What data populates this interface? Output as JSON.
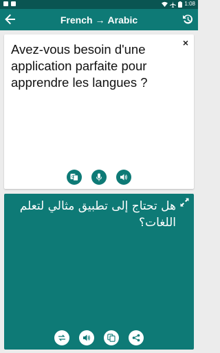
{
  "status_bar": {
    "time": "1:08",
    "icons": [
      "notification-a-icon",
      "notification-square-icon",
      "wifi-icon",
      "airplane-icon",
      "battery-icon"
    ]
  },
  "app_bar": {
    "source_lang": "French",
    "target_lang": "Arabic",
    "arrow": "→",
    "icons": [
      "back-arrow-icon",
      "history-icon"
    ]
  },
  "source": {
    "text": "Avez-vous besoin d'une application parfaite pour apprendre les langues ?",
    "clear_label": "×",
    "actions": [
      "translate-icon",
      "microphone-icon",
      "speaker-icon"
    ]
  },
  "target": {
    "text": "هل تحتاج إلى تطبيق مثالي لتعلم اللغات؟",
    "actions": [
      "swap-icon",
      "speaker-icon",
      "copy-icon",
      "share-icon"
    ],
    "expand_icon": "expand-icon"
  },
  "colors": {
    "status_bar": "#0a5552",
    "primary": "#0e7a76",
    "background": "#ececec",
    "card": "#ffffff"
  }
}
